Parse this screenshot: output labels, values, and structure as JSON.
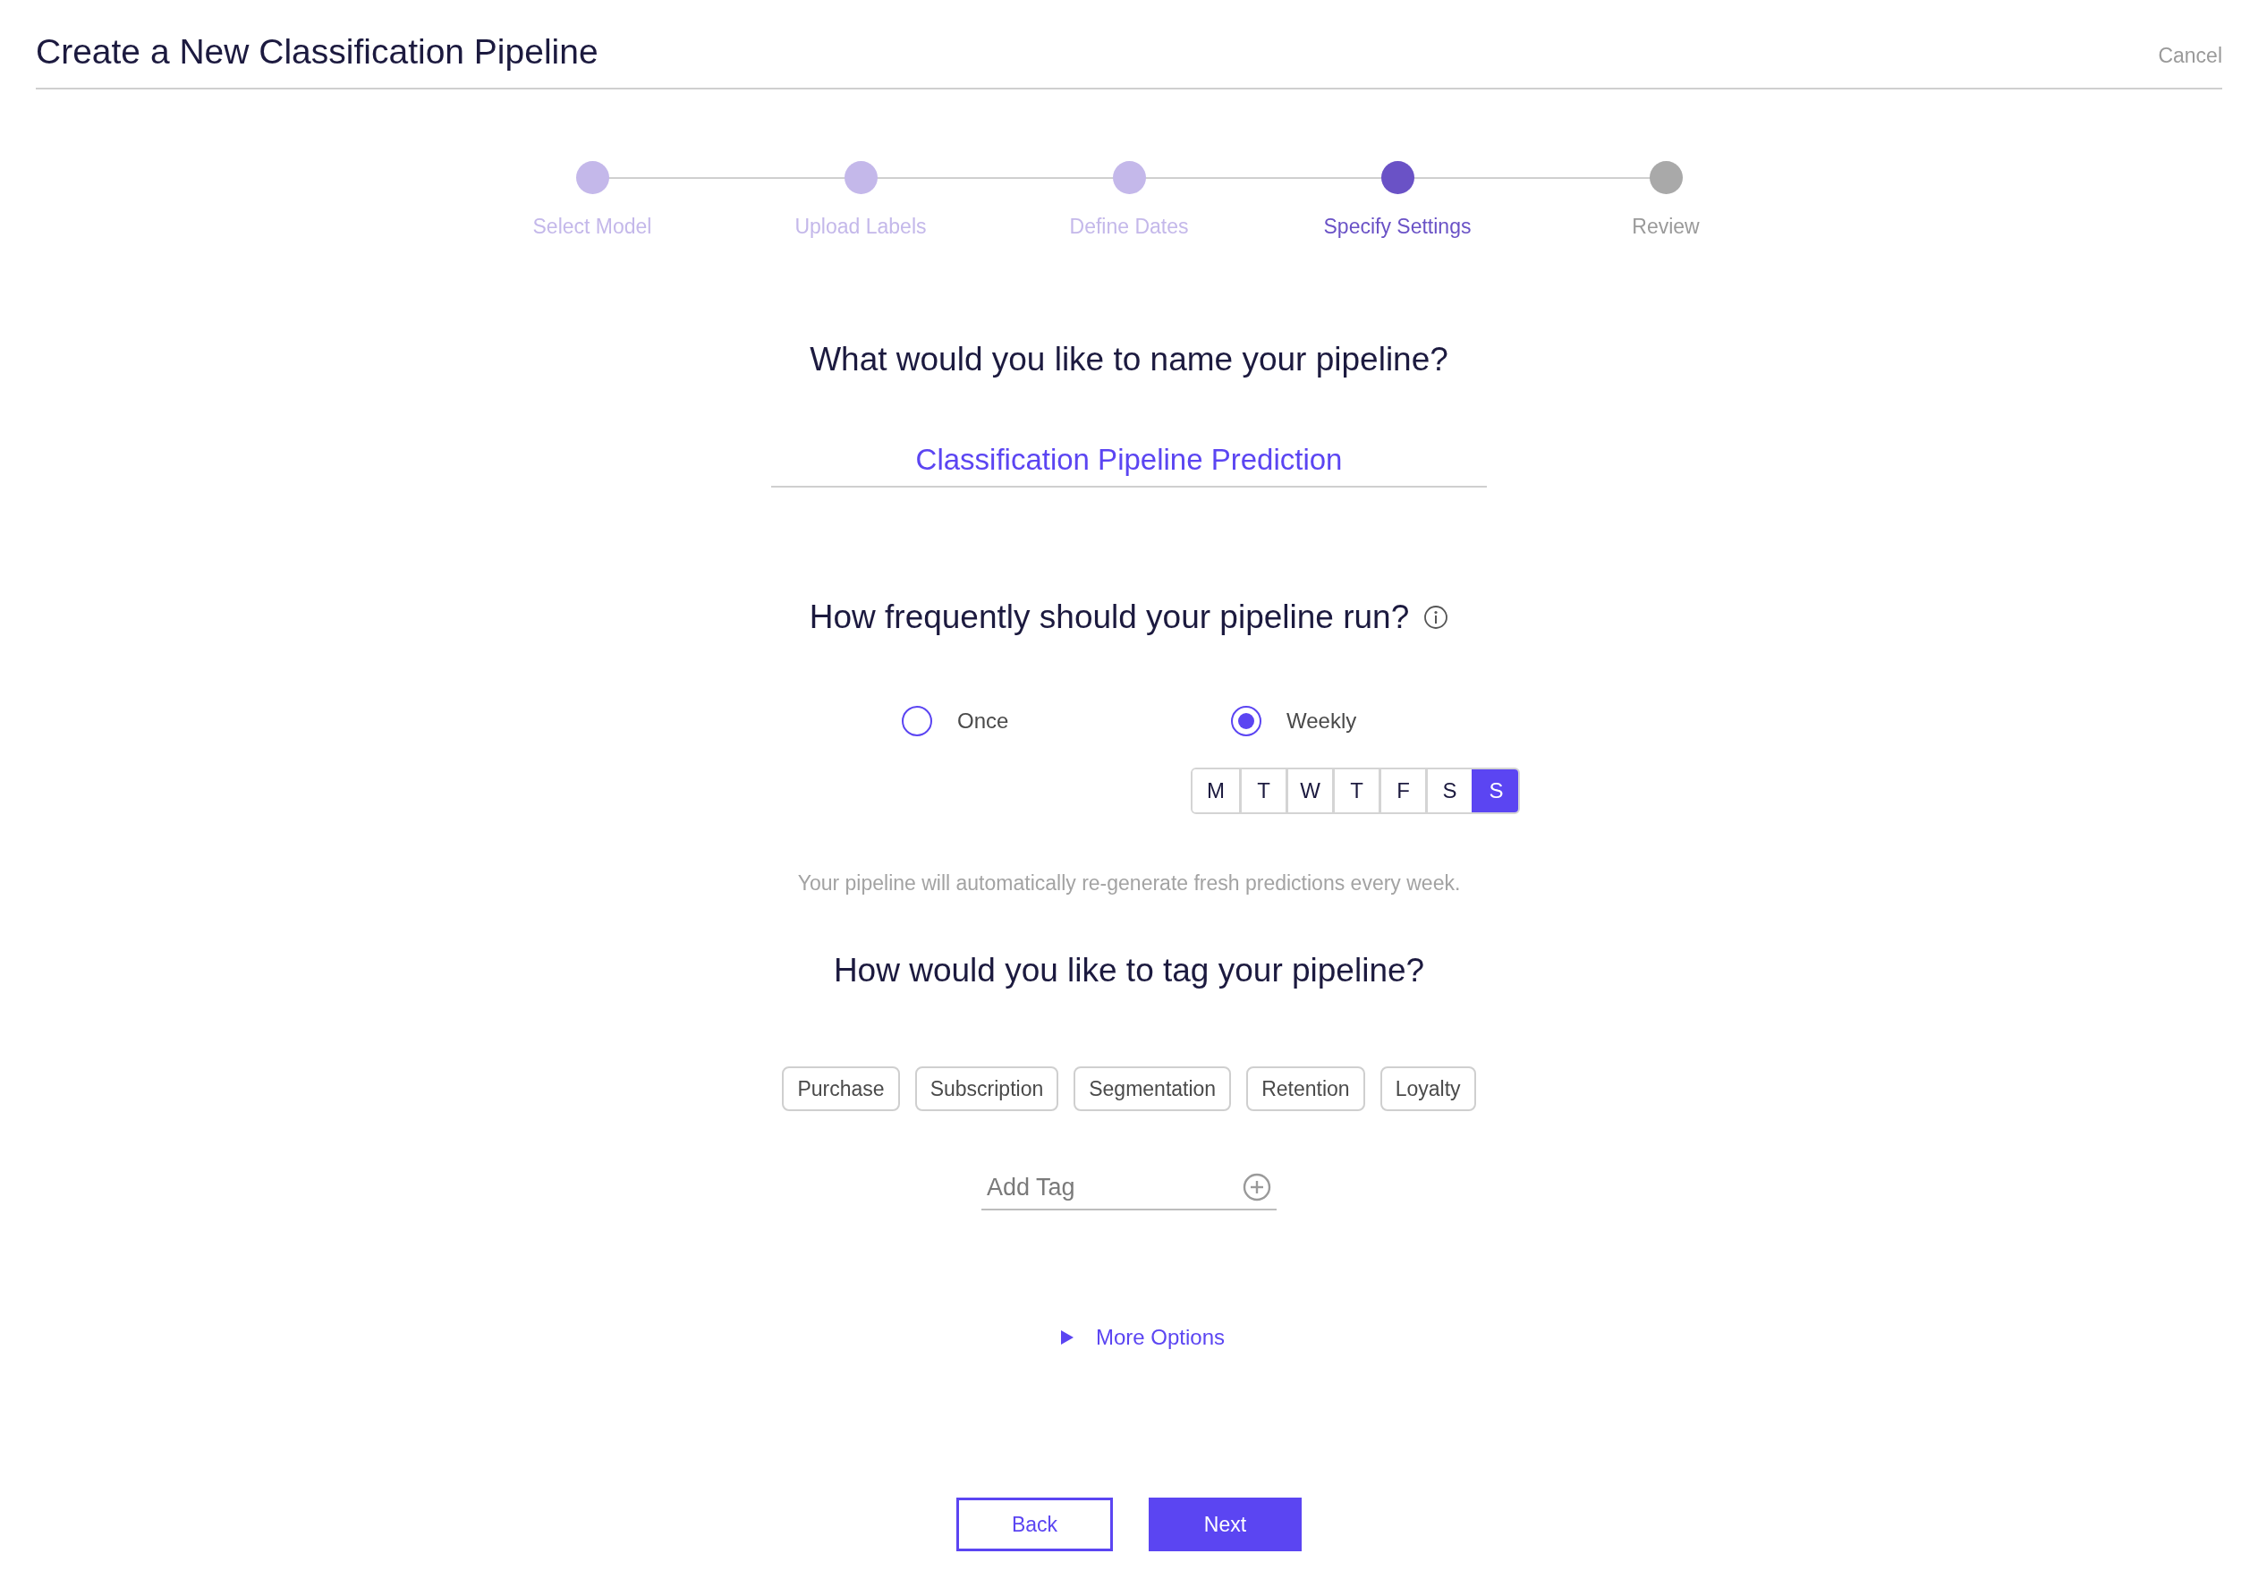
{
  "header": {
    "title": "Create a New Classification Pipeline",
    "cancel": "Cancel"
  },
  "steps": [
    {
      "label": "Select Model",
      "kind": "done"
    },
    {
      "label": "Upload Labels",
      "kind": "done"
    },
    {
      "label": "Define Dates",
      "kind": "done"
    },
    {
      "label": "Specify Settings",
      "kind": "current"
    },
    {
      "label": "Review",
      "kind": "upcoming"
    }
  ],
  "name_section": {
    "question": "What would you like to name your pipeline?",
    "value": "Classification Pipeline Prediction"
  },
  "frequency_section": {
    "question": "How frequently should your pipeline run?",
    "options": [
      {
        "label": "Once",
        "selected": false
      },
      {
        "label": "Weekly",
        "selected": true
      }
    ],
    "days": [
      {
        "label": "M",
        "selected": false
      },
      {
        "label": "T",
        "selected": false
      },
      {
        "label": "W",
        "selected": false
      },
      {
        "label": "T",
        "selected": false
      },
      {
        "label": "F",
        "selected": false
      },
      {
        "label": "S",
        "selected": false
      },
      {
        "label": "S",
        "selected": true
      }
    ],
    "note": "Your pipeline will automatically re-generate fresh predictions every week."
  },
  "tag_section": {
    "question": "How would you like to tag your pipeline?",
    "tags": [
      "Purchase",
      "Subscription",
      "Segmentation",
      "Retention",
      "Loyalty"
    ],
    "add_placeholder": "Add Tag"
  },
  "more_options": {
    "label": "More Options",
    "expanded": false
  },
  "buttons": {
    "back": "Back",
    "next": "Next"
  }
}
